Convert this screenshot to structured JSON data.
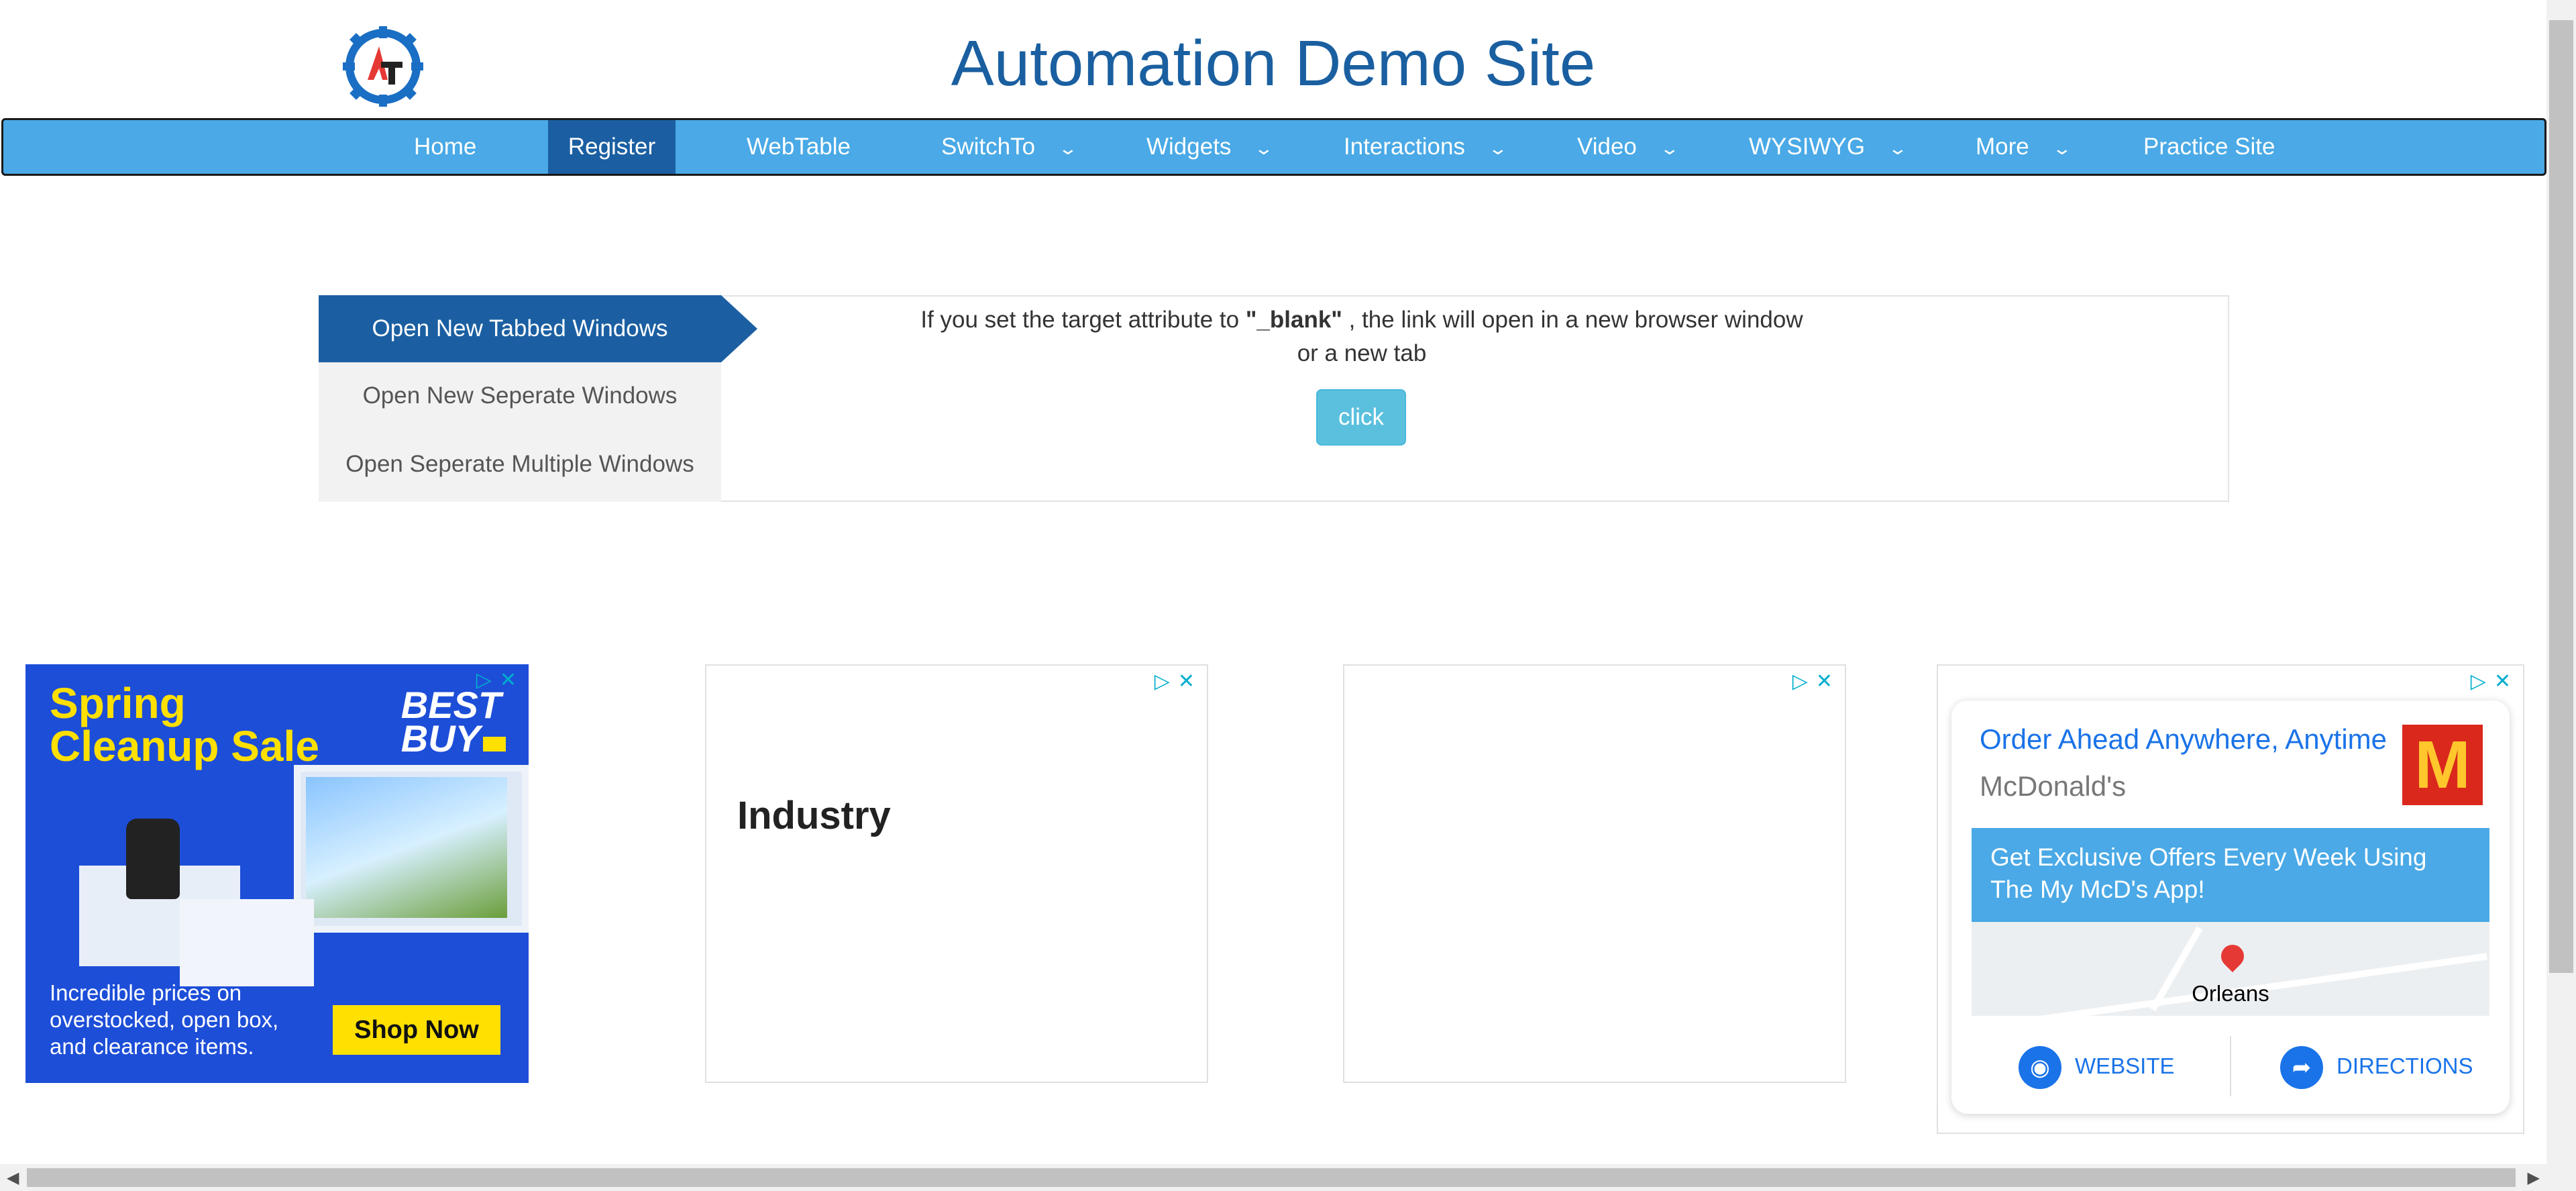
{
  "header": {
    "title": "Automation Demo Site",
    "logo_text": "AT"
  },
  "nav": {
    "items": [
      {
        "label": "Home"
      },
      {
        "label": "Register"
      },
      {
        "label": "WebTable"
      },
      {
        "label": "SwitchTo"
      },
      {
        "label": "Widgets"
      },
      {
        "label": "Interactions"
      },
      {
        "label": "Video"
      },
      {
        "label": "WYSIWYG"
      },
      {
        "label": "More"
      },
      {
        "label": "Practice Site"
      }
    ],
    "active": "Register",
    "chevron": "⌄"
  },
  "tabs": [
    {
      "label": "Open New Tabbed Windows"
    },
    {
      "label": "Open New Seperate Windows"
    },
    {
      "label": "Open Seperate Multiple Windows"
    }
  ],
  "content": {
    "desc_before": "If you set the target attribute to ",
    "desc_bold": "\"_blank\"",
    "desc_after": " , the link will open in a new browser window",
    "desc_line2": "or a new tab",
    "button_label": "click"
  },
  "ads": {
    "bestbuy": {
      "headline_1": "Spring",
      "headline_2": "Cleanup Sale",
      "brand_1": "BEST",
      "brand_2": "BUY",
      "copy_1": "Incredible prices on",
      "copy_2": "overstocked, open box,",
      "copy_3": "and clearance items.",
      "cta": "Shop Now"
    },
    "industry": {
      "word": "Industry"
    },
    "mcdonalds": {
      "title": "Order Ahead Anywhere, Anytime",
      "brand": "McDonald's",
      "logo": "M",
      "offer": "Get Exclusive Offers Every Week Using The My McD's App!",
      "map_label": "Orleans",
      "website": "WEBSITE",
      "directions": "DIRECTIONS"
    },
    "adchoices_icon": "▷✕",
    "colors": {
      "accent": "#4aa9e6",
      "active": "#1b5fa2",
      "title": "#1a5fa0"
    }
  }
}
